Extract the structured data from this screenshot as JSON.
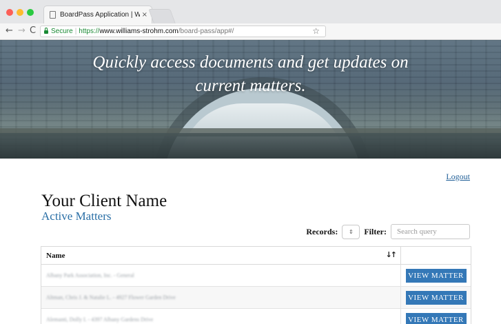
{
  "browser": {
    "tab_title": "BoardPass Application | William",
    "tab_close": "×",
    "secure_label": "Secure",
    "url_scheme": "https://",
    "url_host": "www.williams-strohm.com",
    "url_path": "/board-pass/app#/",
    "back_glyph": "←",
    "forward_glyph": "→",
    "reload_glyph": "C",
    "bookmark_glyph": "☆"
  },
  "hero": {
    "tagline_line1": "Quickly access documents and get updates on",
    "tagline_line2": "current matters."
  },
  "header": {
    "logout_label": "Logout",
    "client_name": "Your Client Name",
    "section_title": "Active Matters"
  },
  "controls": {
    "records_label": "Records:",
    "records_select_glyph": "⇕",
    "filter_label": "Filter:",
    "search_placeholder": "Search query"
  },
  "table": {
    "columns": {
      "name": "Name",
      "sort_glyph": "↓↑"
    },
    "rows": [
      {
        "name": "Albany Park Association, Inc. - General",
        "action_label": "VIEW MATTER"
      },
      {
        "name": "Altman, Chris J. & Natalie L. - 4927 Flower Garden Drive",
        "action_label": "VIEW MATTER"
      },
      {
        "name": "Alemanti, Dolly I. - 4397 Albany Gardens Drive",
        "action_label": "VIEW MATTER"
      }
    ]
  },
  "colors": {
    "accent": "#3478b7",
    "link": "#1f5e97",
    "section_title": "#2a6fa6"
  }
}
